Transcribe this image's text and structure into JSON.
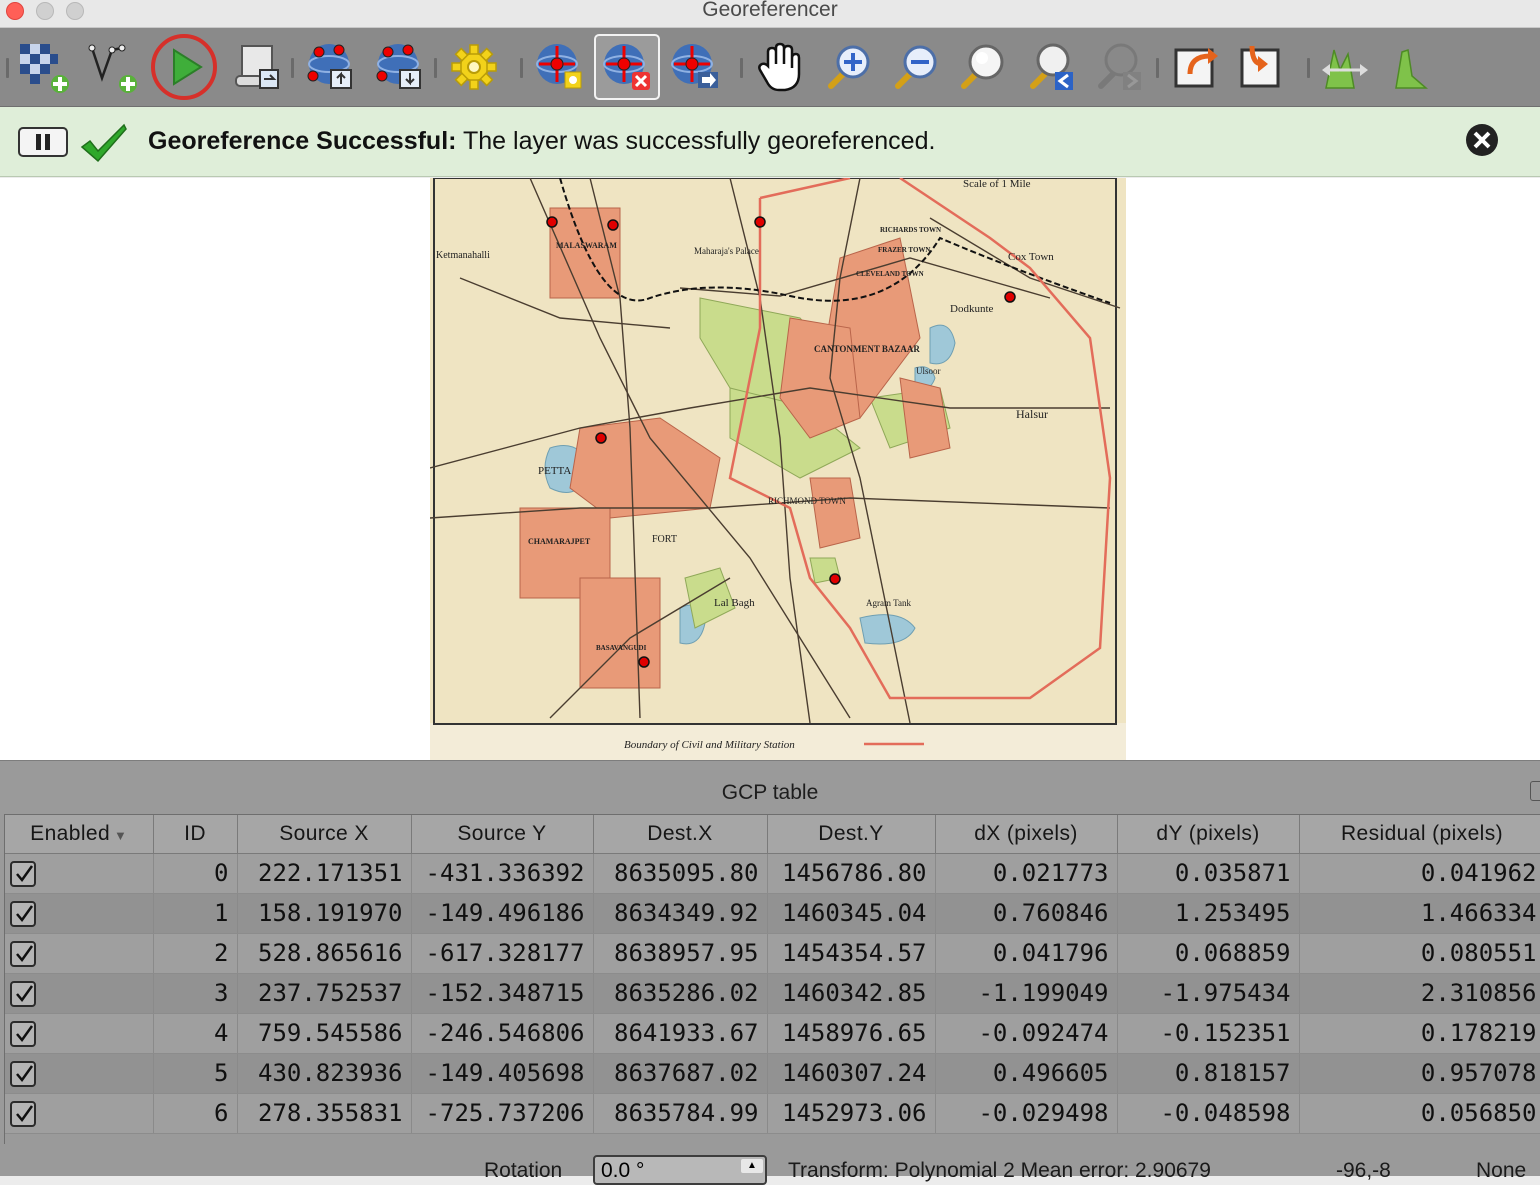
{
  "window": {
    "title": "Georeferencer"
  },
  "toolbar": {
    "buttons": [
      {
        "name": "open-raster-button",
        "icon": "raster-add-icon"
      },
      {
        "name": "start-georeferencing-button",
        "icon": "vector-add-icon"
      },
      {
        "name": "run-button",
        "icon": "play-icon",
        "highlighted": true
      },
      {
        "name": "generate-gdal-script-button",
        "icon": "script-icon"
      },
      {
        "name": "load-gcp-points-button",
        "icon": "gcp-load-icon"
      },
      {
        "name": "save-gcp-points-button",
        "icon": "gcp-save-icon"
      },
      {
        "name": "transformation-settings-button",
        "icon": "gear-icon"
      },
      {
        "name": "add-point-button",
        "icon": "add-point-icon"
      },
      {
        "name": "delete-point-button",
        "icon": "delete-point-icon",
        "active": true
      },
      {
        "name": "move-gcp-point-button",
        "icon": "move-point-icon"
      },
      {
        "name": "pan-button",
        "icon": "hand-icon"
      },
      {
        "name": "zoom-in-button",
        "icon": "zoom-in-icon"
      },
      {
        "name": "zoom-out-button",
        "icon": "zoom-out-icon"
      },
      {
        "name": "zoom-to-layer-button",
        "icon": "zoom-layer-icon"
      },
      {
        "name": "zoom-last-button",
        "icon": "zoom-last-icon"
      },
      {
        "name": "zoom-next-button",
        "icon": "zoom-next-icon",
        "disabled": true
      },
      {
        "name": "link-georef-to-qgis-button",
        "icon": "link-out-icon"
      },
      {
        "name": "link-qgis-to-georef-button",
        "icon": "link-in-icon"
      },
      {
        "name": "full-histogram-stretch-button",
        "icon": "stretch-icon"
      },
      {
        "name": "local-histogram-stretch-button",
        "icon": "histogram-icon"
      }
    ]
  },
  "message": {
    "title": "Georeference Successful:",
    "text": "The layer was successfully georeferenced."
  },
  "map": {
    "labels": {
      "scale": "Scale of 1 Mile",
      "cox_town": "Cox Town",
      "ketmanahalli": "Ketmanahalli",
      "malaswaram": "MALASWARAM",
      "maharaja_palace": "Maharaja's Palace",
      "cantonment": "CANTONMENT BAZAAR",
      "dodkunte": "Dodkunte",
      "halsur": "Halsur",
      "petta": "PETTA",
      "fort": "FORT",
      "richmond": "RICHMOND TOWN",
      "lal_bagh": "Lal Bagh",
      "chamrajpet": "CHAMARAJPET",
      "basavangudi": "BASAVANGUDI",
      "boundary": "Boundary of Civil and Military Station",
      "richards": "RICHARDS TOWN",
      "frazer": "FRAZER TOWN",
      "cleveland": "CLEVELAND TOWN",
      "ulsoor": "Ulsoor",
      "agram": "Agram Tank"
    }
  },
  "gcp_table": {
    "title": "GCP table",
    "columns": [
      "Enabled",
      "ID",
      "Source X",
      "Source Y",
      "Dest.X",
      "Dest.Y",
      "dX (pixels)",
      "dY (pixels)",
      "Residual (pixels)"
    ],
    "rows": [
      {
        "enabled": true,
        "id": "0",
        "src_x": "222.171351",
        "src_y": "-431.336392",
        "dest_x": "8635095.80",
        "dest_y": "1456786.80",
        "dx": "0.021773",
        "dy": "0.035871",
        "residual": "0.041962"
      },
      {
        "enabled": true,
        "id": "1",
        "src_x": "158.191970",
        "src_y": "-149.496186",
        "dest_x": "8634349.92",
        "dest_y": "1460345.04",
        "dx": "0.760846",
        "dy": "1.253495",
        "residual": "1.466334"
      },
      {
        "enabled": true,
        "id": "2",
        "src_x": "528.865616",
        "src_y": "-617.328177",
        "dest_x": "8638957.95",
        "dest_y": "1454354.57",
        "dx": "0.041796",
        "dy": "0.068859",
        "residual": "0.080551"
      },
      {
        "enabled": true,
        "id": "3",
        "src_x": "237.752537",
        "src_y": "-152.348715",
        "dest_x": "8635286.02",
        "dest_y": "1460342.85",
        "dx": "-1.199049",
        "dy": "-1.975434",
        "residual": "2.310856"
      },
      {
        "enabled": true,
        "id": "4",
        "src_x": "759.545586",
        "src_y": "-246.546806",
        "dest_x": "8641933.67",
        "dest_y": "1458976.65",
        "dx": "-0.092474",
        "dy": "-0.152351",
        "residual": "0.178219"
      },
      {
        "enabled": true,
        "id": "5",
        "src_x": "430.823936",
        "src_y": "-149.405698",
        "dest_x": "8637687.02",
        "dest_y": "1460307.24",
        "dx": "0.496605",
        "dy": "0.818157",
        "residual": "0.957078"
      },
      {
        "enabled": true,
        "id": "6",
        "src_x": "278.355831",
        "src_y": "-725.737206",
        "dest_x": "8635784.99",
        "dest_y": "1452973.06",
        "dx": "-0.029498",
        "dy": "-0.048598",
        "residual": "0.056850"
      }
    ]
  },
  "status": {
    "rotation_label": "Rotation",
    "rotation_value": "0.0 °",
    "transform": "Transform: Polynomial 2 Mean error: 2.90679",
    "coords": "-96,-8",
    "crs": "None"
  },
  "colors": {
    "toolbar_bg": "#8a8a8a",
    "message_bg": "#dfeed9",
    "gcp_point": "#e00000",
    "run_highlight": "#d6302a",
    "map_paper": "#f2e6c4",
    "map_built": "#e89a78",
    "map_park": "#c9dc8c",
    "map_water": "#9fc8d8"
  }
}
